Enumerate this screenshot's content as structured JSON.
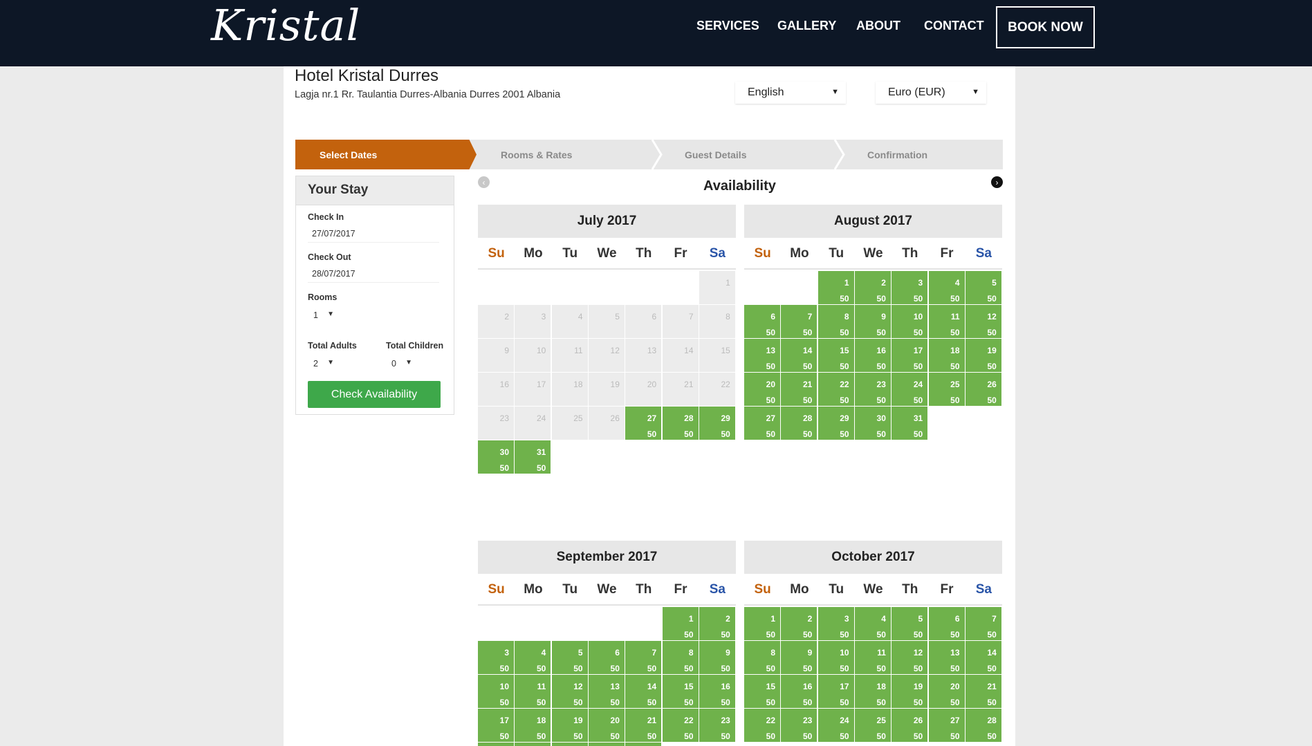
{
  "brand": {
    "logo_text": "Kristal"
  },
  "nav": {
    "services": "SERVICES",
    "gallery": "GALLERY",
    "about": "ABOUT",
    "contact": "CONTACT",
    "book_now": "BOOK NOW"
  },
  "hotel": {
    "name": "Hotel Kristal Durres",
    "address": "Lagja nr.1 Rr. Taulantia Durres-Albania Durres 2001 Albania"
  },
  "selectors": {
    "language": "English",
    "currency": "Euro (EUR)"
  },
  "steps": [
    "Select Dates",
    "Rooms & Rates",
    "Guest Details",
    "Confirmation"
  ],
  "your_stay": {
    "title": "Your Stay",
    "check_in_label": "Check In",
    "check_in_value": "27/07/2017",
    "check_out_label": "Check Out",
    "check_out_value": "28/07/2017",
    "rooms_label": "Rooms",
    "rooms_value": "1",
    "adults_label": "Total Adults",
    "adults_value": "2",
    "children_label": "Total Children",
    "children_value": "0",
    "button": "Check Availability"
  },
  "availability": {
    "title": "Availability",
    "weekdays": [
      "Su",
      "Mo",
      "Tu",
      "We",
      "Th",
      "Fr",
      "Sa"
    ],
    "price": "50",
    "months": [
      {
        "name": "July 2017",
        "first_weekday": 6,
        "days": 31,
        "available_from": 27
      },
      {
        "name": "August 2017",
        "first_weekday": 2,
        "days": 31,
        "available_from": 1
      },
      {
        "name": "September 2017",
        "first_weekday": 5,
        "days": 28,
        "available_from": 1
      },
      {
        "name": "October 2017",
        "first_weekday": 0,
        "days": 28,
        "available_from": 1
      }
    ]
  }
}
